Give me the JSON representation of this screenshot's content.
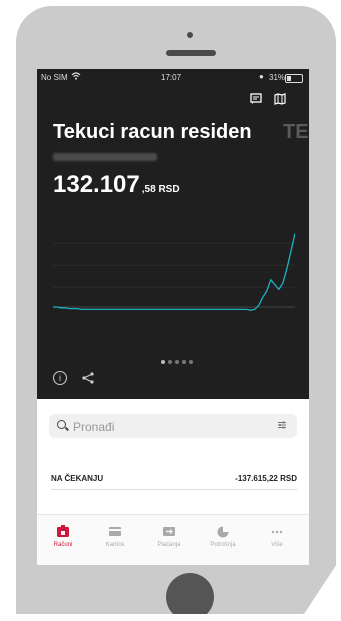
{
  "status_bar": {
    "carrier": "No SIM",
    "time": "17:07",
    "battery": "31%",
    "battery_level": 0.31
  },
  "account": {
    "title": "Tekuci racun residen",
    "next_title_partial": "TE",
    "balance_main": "132.107",
    "balance_decimal": ",58 RSD"
  },
  "chart_data": {
    "type": "line",
    "x": [
      0,
      1,
      2,
      3,
      4,
      5,
      6,
      7,
      8,
      9,
      10,
      11,
      12,
      13,
      14,
      15,
      16,
      17,
      18,
      19,
      20,
      21,
      22,
      23,
      24,
      25,
      26,
      27,
      28,
      29,
      30,
      31,
      32,
      33,
      34,
      35,
      36,
      37,
      38,
      39,
      40,
      41,
      42,
      43,
      44,
      45,
      46,
      47,
      48,
      49,
      50,
      51,
      52,
      53,
      54,
      55,
      56,
      57,
      58,
      59,
      60
    ],
    "y": [
      0,
      0,
      -1,
      -1,
      -2,
      -2,
      -2,
      -3,
      -3,
      -3,
      -3,
      -3,
      -3,
      -3,
      -3,
      -3,
      -3,
      -3,
      -3,
      -3,
      -3,
      -3,
      -3,
      -3,
      -3,
      -3,
      -3,
      -3,
      -3,
      -3,
      -3,
      -3,
      -3,
      -3,
      -3,
      -3,
      -3,
      -3,
      -3,
      -3,
      -3,
      -3,
      -3,
      -3,
      -3,
      -3,
      -3,
      -3,
      -3,
      -4,
      -3,
      2,
      12,
      20,
      34,
      28,
      22,
      30,
      48,
      70,
      92
    ],
    "series_color": "#1ab3c4",
    "ylim": [
      -10,
      100
    ]
  },
  "carousel": {
    "count": 5,
    "active": 0
  },
  "search": {
    "placeholder": "Pronađi"
  },
  "pending": {
    "label": "NA ČEKANJU",
    "amount": "-137.615,22 RSD"
  },
  "tabs": [
    {
      "label": "Računi",
      "icon": "accounts-icon",
      "active": true
    },
    {
      "label": "Kartice",
      "icon": "card-icon",
      "active": false
    },
    {
      "label": "Plaćanja",
      "icon": "payment-icon",
      "active": false
    },
    {
      "label": "Potrošnja",
      "icon": "pie-chart-icon",
      "active": false
    },
    {
      "label": "Više",
      "icon": "more-icon",
      "active": false
    }
  ],
  "colors": {
    "accent": "#d0163a",
    "dark_bg": "#1f1f1f",
    "chart_line": "#1ab3c4"
  }
}
